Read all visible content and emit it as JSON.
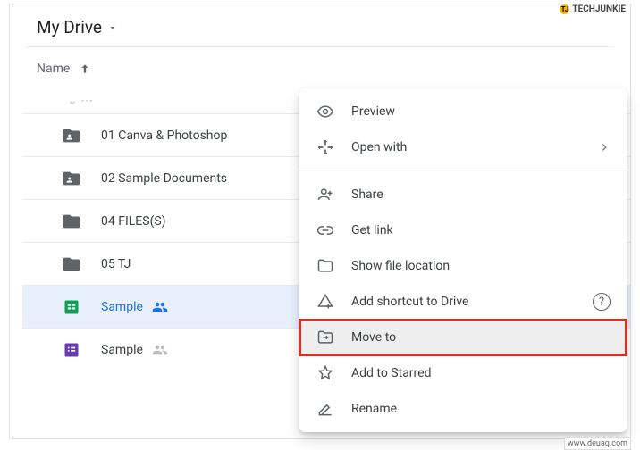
{
  "watermark_top": "TECHJUNKIE",
  "watermark_bottom": "www.deuaq.com",
  "header": {
    "title": "My Drive"
  },
  "columns": {
    "name": "Name"
  },
  "rows": [
    {
      "label": "01 Canva & Photoshop",
      "type": "folder_shared"
    },
    {
      "label": "02 Sample Documents",
      "type": "folder_shared"
    },
    {
      "label": "04 FILES(S)",
      "type": "folder"
    },
    {
      "label": "05 TJ",
      "type": "folder"
    },
    {
      "label": "Sample",
      "type": "sheets",
      "shared": true,
      "selected": true
    },
    {
      "label": "Sample",
      "type": "forms",
      "shared": true
    }
  ],
  "menu": {
    "preview": "Preview",
    "open_with": "Open with",
    "share": "Share",
    "get_link": "Get link",
    "show_location": "Show file location",
    "add_shortcut": "Add shortcut to Drive",
    "move_to": "Move to",
    "add_starred": "Add to Starred",
    "rename": "Rename"
  }
}
